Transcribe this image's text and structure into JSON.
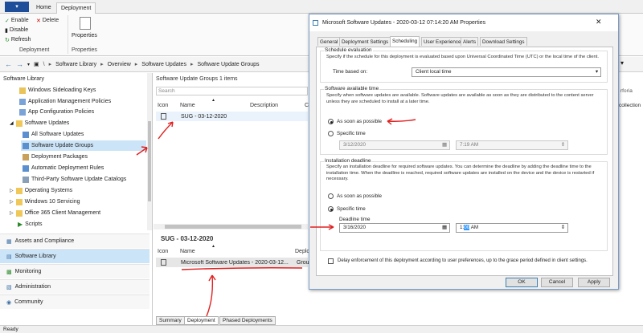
{
  "ribbon": {
    "tabs": [
      "Home",
      "Deployment"
    ],
    "active_tab": "Deployment",
    "buttons": {
      "enable": "Enable",
      "delete": "Delete",
      "disable": "Disable",
      "refresh": "Refresh",
      "properties": "Properties"
    },
    "groups": {
      "deployment": "Deployment",
      "properties": "Properties"
    }
  },
  "breadcrumb": [
    "Software Library",
    "Overview",
    "Software Updates",
    "Software Update Groups"
  ],
  "nav": {
    "title": "Software Library",
    "items": [
      "Windows Sideloading Keys",
      "Application Management Policies",
      "App Configuration Policies",
      "Software Updates",
      "All Software Updates",
      "Software Update Groups",
      "Deployment Packages",
      "Automatic Deployment Rules",
      "Third-Party Software Update Catalogs",
      "Operating Systems",
      "Windows 10 Servicing",
      "Office 365 Client Management",
      "Scripts"
    ],
    "workspaces": [
      "Assets and Compliance",
      "Software Library",
      "Monitoring",
      "Administration",
      "Community"
    ]
  },
  "main": {
    "title": "Software Update Groups 1 items",
    "search_placeholder": "Search",
    "columns": [
      "Icon",
      "Name",
      "Description",
      "C"
    ],
    "rows": [
      {
        "name": "SUG - 03-12-2020"
      }
    ],
    "detail_title": "SUG - 03-12-2020",
    "detail_columns": [
      "Icon",
      "Name",
      "Deploy"
    ],
    "detail_rows": [
      {
        "name": "Microsoft Software Updates - 2020-03-12...",
        "extra": "Grou"
      }
    ],
    "bottom_tabs": [
      "Summary",
      "Deployment",
      "Phased Deployments"
    ],
    "right_fragments": {
      "r1": "rforia",
      "r2": "collection"
    }
  },
  "dialog": {
    "title": "Microsoft Software Updates - 2020-03-12 07:14:20 AM Properties",
    "tabs": [
      "General",
      "Deployment Settings",
      "Scheduling",
      "User Experience",
      "Alerts",
      "Download Settings"
    ],
    "active_tab": "Scheduling",
    "schedule_eval": {
      "title": "Schedule evaluation",
      "desc": "Specify if the schedule for this deployment is evaluated based upon Universal Coordinated Time (UTC) or the local time of the client.",
      "time_based_label": "Time based on:",
      "time_based_value": "Client local time"
    },
    "available": {
      "title": "Software available time",
      "desc": "Specify when software updates are available. Software updates are available as soon as they are distributed to the content server unless they are scheduled to install at a later time.",
      "asap": "As soon as possible",
      "specific": "Specific time",
      "date": "3/12/2020",
      "time": "7:19 AM"
    },
    "deadline": {
      "title": "Installation deadline",
      "desc": "Specify an installation deadline for required software updates. You can determine the deadline by adding the deadline time to the installation time. When the deadline is reached, required software updates are installed on the device and the device is restarted if necessary.",
      "asap": "As soon as possible",
      "specific": "Specific time",
      "deadline_label": "Deadline time",
      "date": "3/16/2020",
      "time_hour": "1",
      "time_min": "00",
      "time_ampm": "AM"
    },
    "delay_label": "Delay enforcement of this deployment according to user preferences, up to the grace period defined in client settings.",
    "buttons": {
      "ok": "OK",
      "cancel": "Cancel",
      "apply": "Apply"
    }
  },
  "status": "Ready",
  "colors": {
    "accent": "#1e4e99",
    "annotation": "#e02020",
    "selected": "#cce4f7"
  }
}
